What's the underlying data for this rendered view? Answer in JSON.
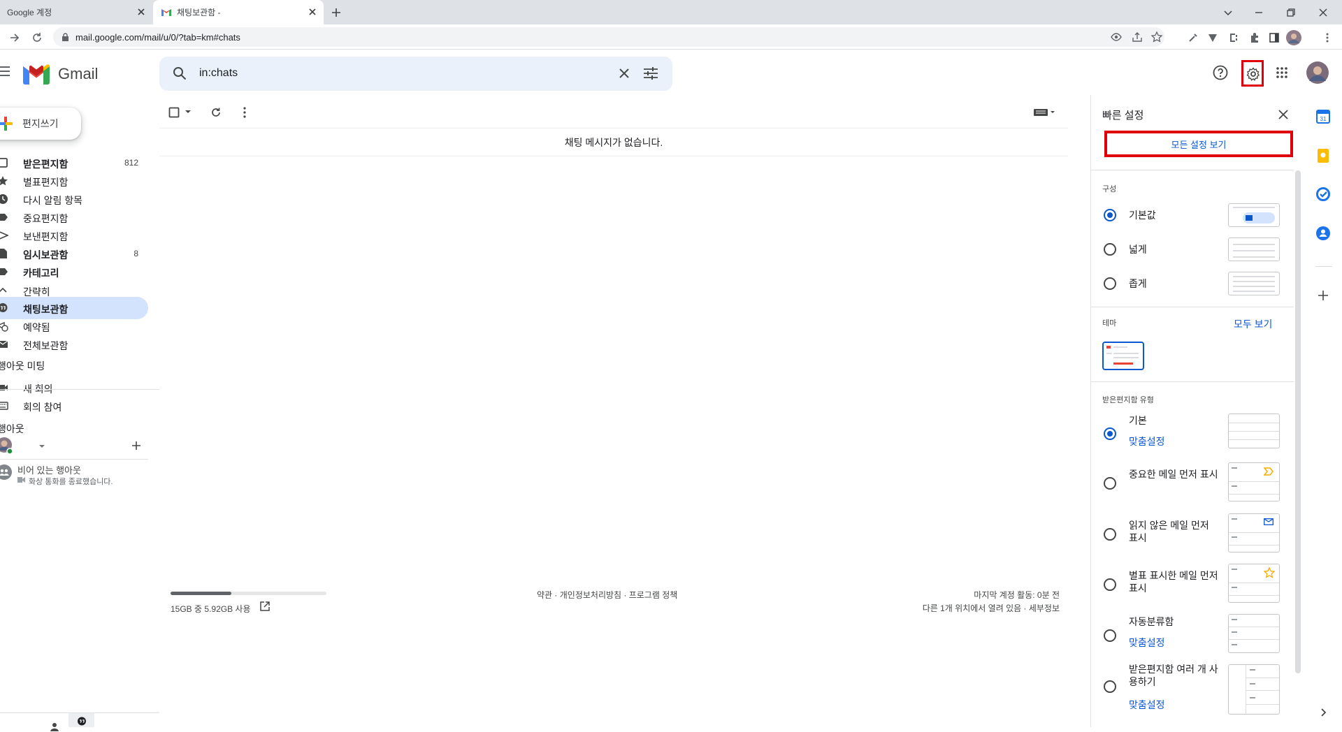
{
  "browser": {
    "tabs": [
      {
        "title": "Google 계정"
      },
      {
        "title": "채팅보관함 -"
      }
    ],
    "url": "mail.google.com/mail/u/0/?tab=km#chats"
  },
  "gmail": {
    "logo_text": "Gmail",
    "search_value": "in:chats"
  },
  "nav": {
    "compose_label": "편지쓰기",
    "items": [
      {
        "label": "받은편지함",
        "count": "812",
        "icon": "inbox-icon"
      },
      {
        "label": "별표편지함",
        "count": "",
        "icon": "star-icon"
      },
      {
        "label": "다시 알림 항목",
        "count": "",
        "icon": "clock-icon"
      },
      {
        "label": "중요편지함",
        "count": "",
        "icon": "label-important-icon"
      },
      {
        "label": "보낸편지함",
        "count": "",
        "icon": "send-icon"
      },
      {
        "label": "임시보관함",
        "count": "8",
        "icon": "draft-icon"
      },
      {
        "label": "카테고리",
        "count": "",
        "icon": "label-icon"
      },
      {
        "label": "간략히",
        "count": "",
        "icon": "chevron-up-icon"
      },
      {
        "label": "채팅보관함",
        "count": "",
        "icon": "chat-icon"
      },
      {
        "label": "예약됨",
        "count": "",
        "icon": "scheduled-icon"
      },
      {
        "label": "전체보관함",
        "count": "",
        "icon": "mail-icon"
      }
    ],
    "meet_title": "행아웃 미팅",
    "meet_items": [
      {
        "label": "새 회의",
        "icon": "video-icon"
      },
      {
        "label": "회의 참여",
        "icon": "keyboard-icon"
      }
    ],
    "hangouts_title": "행아웃",
    "hangouts_empty": "비어 있는 행아웃",
    "hangouts_status": "화상 통화를 종료했습니다."
  },
  "main": {
    "empty_message": "채팅 메시지가 없습니다.",
    "storage": "15GB 중 5.92GB 사용",
    "storage_fraction": 0.39,
    "footer_links": "약관 · 개인정보처리방침 · 프로그램 정책",
    "last_activity": "마지막 계정 활동: 0분 전",
    "other_locations": "다른 1개 위치에서 열려 있음 · 세부정보"
  },
  "quick_settings": {
    "title": "빠른 설정",
    "all_settings": "모든 설정 보기",
    "density_title": "구성",
    "density_options": [
      {
        "label": "기본값",
        "selected": true
      },
      {
        "label": "넓게",
        "selected": false
      },
      {
        "label": "좁게",
        "selected": false
      }
    ],
    "theme_title": "테마",
    "theme_view_all": "모두 보기",
    "inbox_type_title": "받은편지함 유형",
    "inbox_types": [
      {
        "label": "기본",
        "link": "맞춤설정",
        "selected": true
      },
      {
        "label": "중요한 메일 먼저 표시",
        "link": "",
        "selected": false
      },
      {
        "label": "읽지 않은 메일 먼저 표시",
        "link": "",
        "selected": false
      },
      {
        "label": "별표 표시한 메일 먼저 표시",
        "link": "",
        "selected": false
      },
      {
        "label": "자동분류함",
        "link": "맞춤설정",
        "selected": false
      },
      {
        "label": "받은편지함 여러 개 사용하기",
        "link": "맞춤설정",
        "selected": false
      }
    ]
  },
  "colors": {
    "accent": "#0b57d0",
    "highlight": "#e0000a",
    "active_nav": "#d3e3fd"
  }
}
